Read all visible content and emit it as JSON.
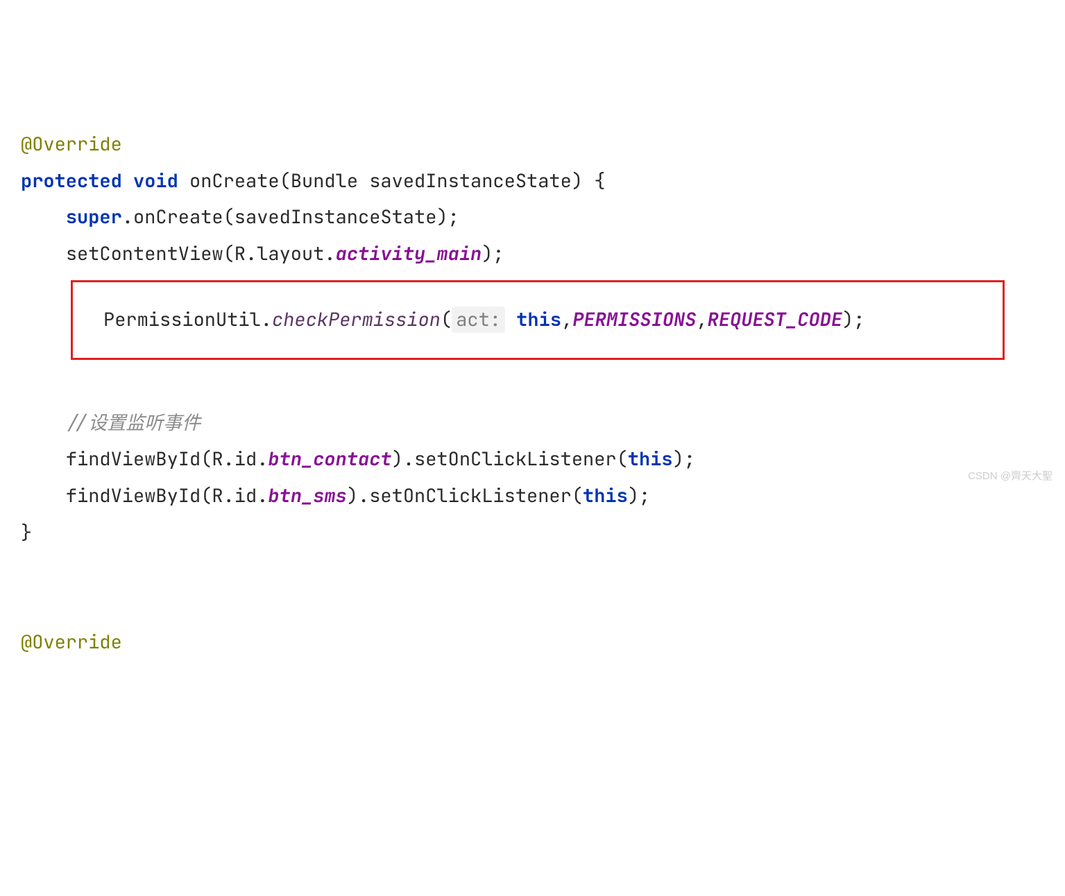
{
  "code": {
    "annotation1": "@Override",
    "kw_protected": "protected",
    "kw_void": "void",
    "sig_onCreate": " onCreate(Bundle savedInstanceState) {",
    "kw_super": "super",
    "super_tail": ".onCreate(savedInstanceState);",
    "setContent_head": "setContentView(R.layout.",
    "activity_main": "activity_main",
    "close_paren_semi": ");",
    "perm_head": "PermissionUtil.",
    "checkPermission": "checkPermission",
    "open_paren": "(",
    "hint_act": "act:",
    "space": " ",
    "kw_this": "this",
    "comma": ",",
    "permissions": "PERMISSIONS",
    "request_code": "REQUEST_CODE",
    "comment_listen": "//设置监听事件",
    "find1_head": "findViewById(R.id.",
    "btn_contact": "btn_contact",
    "find_tail_a": ").setOnClickListener(",
    "find_tail_b": ");",
    "find2_head": "findViewById(R.id.",
    "btn_sms": "btn_sms",
    "close_brace": "}",
    "annotation2": "@Override"
  },
  "watermark": "CSDN @齊天大聖"
}
